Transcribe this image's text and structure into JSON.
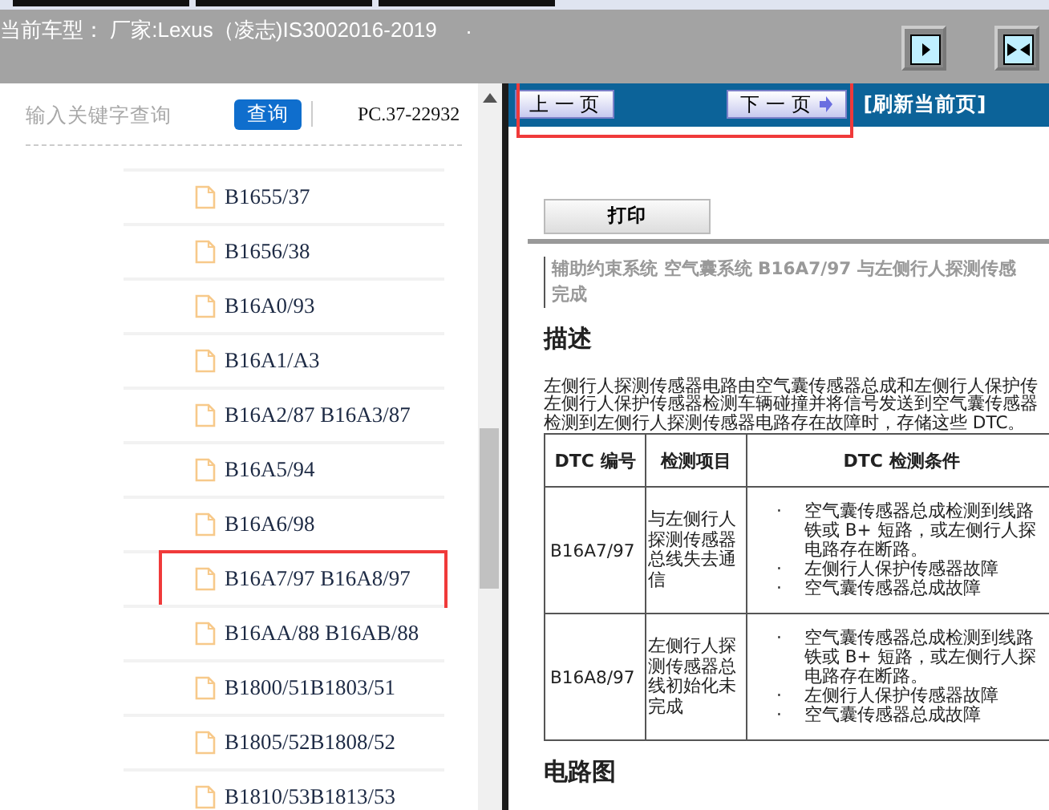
{
  "header": {
    "title": "当前车型： 厂家:Lexus（凌志)IS3002016-2019",
    "dot": "."
  },
  "sidebar": {
    "search": {
      "placeholder": "输入关键字查询"
    },
    "search_button": "查询",
    "code": "PC.37-22932",
    "items": [
      {
        "label": "B1655/37",
        "selected": false
      },
      {
        "label": "B1656/38",
        "selected": false
      },
      {
        "label": "B16A0/93",
        "selected": false
      },
      {
        "label": "B16A1/A3",
        "selected": false
      },
      {
        "label": "B16A2/87 B16A3/87",
        "selected": false
      },
      {
        "label": "B16A5/94",
        "selected": false
      },
      {
        "label": "B16A6/98",
        "selected": false
      },
      {
        "label": "B16A7/97 B16A8/97",
        "selected": true
      },
      {
        "label": "B16AA/88 B16AB/88",
        "selected": false
      },
      {
        "label": "B1800/51B1803/51",
        "selected": false
      },
      {
        "label": "B1805/52B1808/52",
        "selected": false
      },
      {
        "label": "B1810/53B1813/53",
        "selected": false
      }
    ]
  },
  "nav": {
    "prev": "上 一 页",
    "next": "下 一 页",
    "refresh": "[刷新当前页]",
    "highlighted": true
  },
  "document": {
    "print_button": "打印",
    "breadcrumb": [
      "辅助约束系统  空气囊系统  B16A7/97  与左侧行人探测传感",
      "完成"
    ],
    "heading": "描述",
    "paragraph": [
      "左侧行人探测传感器电路由空气囊传感器总成和左侧行人保护传",
      "左侧行人保护传感器检测车辆碰撞并将信号发送到空气囊传感器",
      "检测到左侧行人探测传感器电路存在故障时，存储这些 DTC。"
    ],
    "table": {
      "columns": [
        "DTC 编号",
        "检测项目",
        "DTC 检测条件"
      ],
      "rows": [
        {
          "code": "B16A7/97",
          "item": "与左侧行人探测传感器总线失去通信",
          "conditions": [
            {
              "marker": "·",
              "lines": [
                "空气囊传感器总成检测到线路",
                "铁或 B+ 短路，或左侧行人探",
                "电路存在断路。"
              ]
            },
            {
              "marker": "·",
              "lines": [
                "左侧行人保护传感器故障"
              ]
            },
            {
              "marker": "·",
              "lines": [
                "空气囊传感器总成故障"
              ]
            }
          ]
        },
        {
          "code": "B16A8/97",
          "item": "左侧行人探测传感器总线初始化未完成",
          "conditions": [
            {
              "marker": "·",
              "lines": [
                "空气囊传感器总成检测到线路",
                "铁或 B+ 短路，或左侧行人探",
                "电路存在断路。"
              ]
            },
            {
              "marker": "·",
              "lines": [
                "左侧行人保护传感器故障"
              ]
            },
            {
              "marker": "·",
              "lines": [
                "空气囊传感器总成故障"
              ]
            }
          ]
        }
      ]
    },
    "heading_2": "电路图"
  }
}
